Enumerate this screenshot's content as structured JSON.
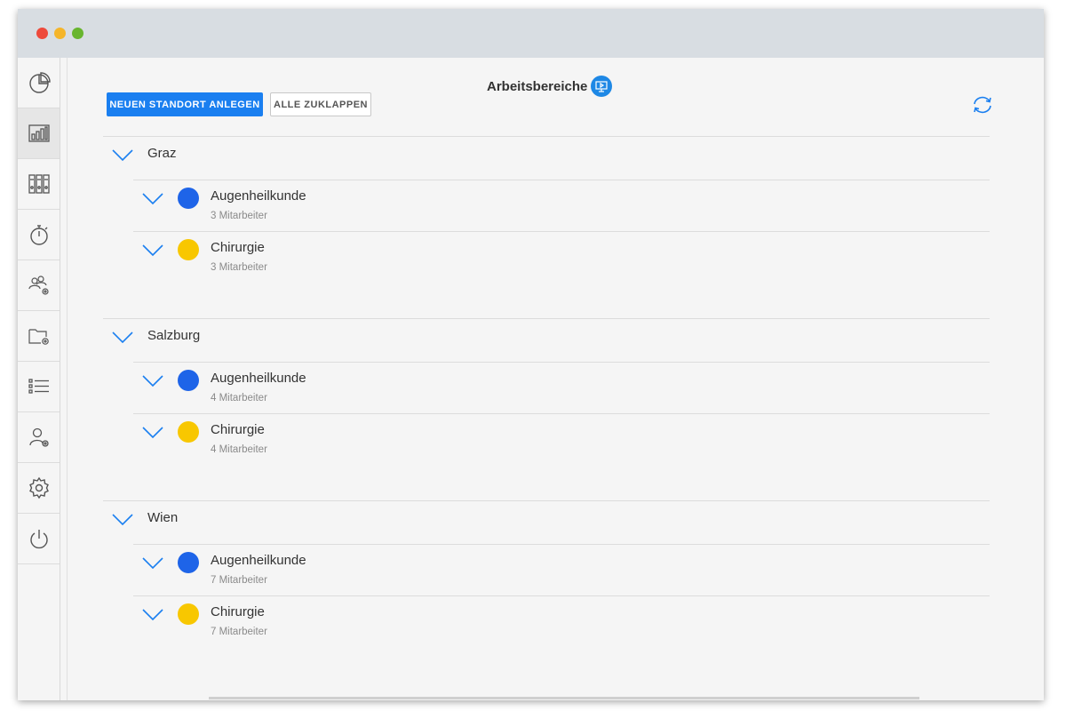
{
  "header": {
    "title": "Arbeitsbereiche"
  },
  "toolbar": {
    "primary_label": "NEUEN STANDORT ANLEGEN",
    "secondary_label": "ALLE ZUKLAPPEN"
  },
  "sidebar": {
    "items": [
      {
        "icon": "pie-chart-icon",
        "active": false
      },
      {
        "icon": "bar-chart-icon",
        "active": true
      },
      {
        "icon": "binders-icon",
        "active": false
      },
      {
        "icon": "stopwatch-icon",
        "active": false
      },
      {
        "icon": "group-settings-icon",
        "active": false
      },
      {
        "icon": "folder-settings-icon",
        "active": false
      },
      {
        "icon": "list-icon",
        "active": false
      },
      {
        "icon": "user-settings-icon",
        "active": false
      },
      {
        "icon": "gear-icon",
        "active": false
      },
      {
        "icon": "power-icon",
        "active": false
      }
    ]
  },
  "colors": {
    "accent": "#1a7ff0",
    "blue_dot": "#1e64e8",
    "yellow_dot": "#f8c700"
  },
  "locations": [
    {
      "name": "Graz",
      "areas": [
        {
          "name": "Augenheilkunde",
          "staff": "3 Mitarbeiter",
          "color": "#1e64e8"
        },
        {
          "name": "Chirurgie",
          "staff": "3 Mitarbeiter",
          "color": "#f8c700"
        }
      ]
    },
    {
      "name": "Salzburg",
      "areas": [
        {
          "name": "Augenheilkunde",
          "staff": "4 Mitarbeiter",
          "color": "#1e64e8"
        },
        {
          "name": "Chirurgie",
          "staff": "4 Mitarbeiter",
          "color": "#f8c700"
        }
      ]
    },
    {
      "name": "Wien",
      "areas": [
        {
          "name": "Augenheilkunde",
          "staff": "7 Mitarbeiter",
          "color": "#1e64e8"
        },
        {
          "name": "Chirurgie",
          "staff": "7 Mitarbeiter",
          "color": "#f8c700"
        }
      ]
    }
  ]
}
